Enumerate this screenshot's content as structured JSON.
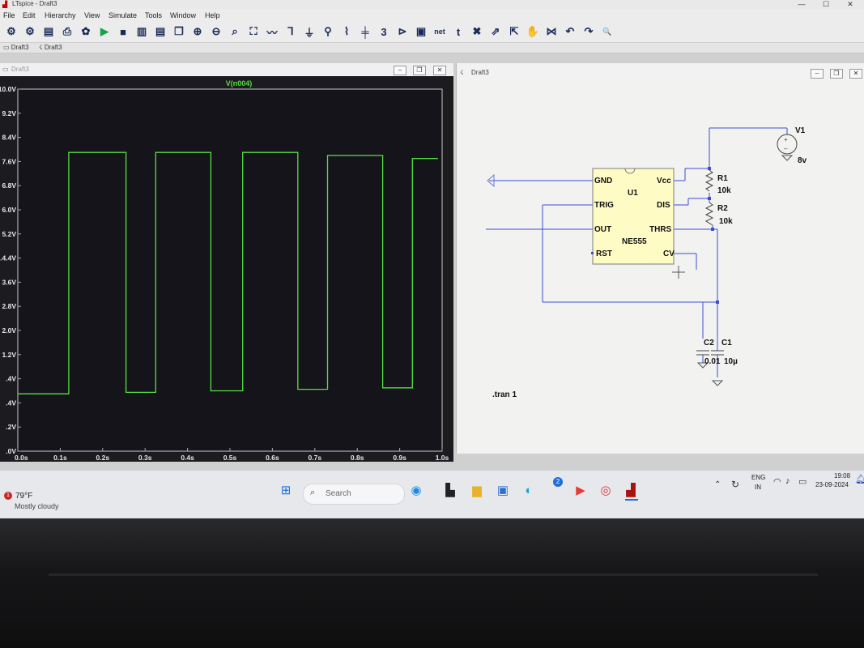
{
  "window": {
    "title": "LTspice - Draft3",
    "minimize": "—",
    "maximize": "☐",
    "close": "✕"
  },
  "menu": [
    "File",
    "Edit",
    "Hierarchy",
    "View",
    "Simulate",
    "Tools",
    "Window",
    "Help"
  ],
  "toolbar_icons": [
    {
      "name": "open-icon",
      "glyph": "⚙"
    },
    {
      "name": "open-folder-icon",
      "glyph": "⚙"
    },
    {
      "name": "save-icon",
      "glyph": "▤"
    },
    {
      "name": "print-icon",
      "glyph": "⎙"
    },
    {
      "name": "control-panel-icon",
      "glyph": "✿"
    },
    {
      "name": "run-icon",
      "glyph": "▶"
    },
    {
      "name": "halt-icon",
      "glyph": "■"
    },
    {
      "name": "tile-vertical-icon",
      "glyph": "▥"
    },
    {
      "name": "tile-horizontal-icon",
      "glyph": "▤"
    },
    {
      "name": "cascade-icon",
      "glyph": "❐"
    },
    {
      "name": "zoom-in-icon",
      "glyph": "⊕"
    },
    {
      "name": "zoom-out-icon",
      "glyph": "⊖"
    },
    {
      "name": "zoom-area-icon",
      "glyph": "⌕"
    },
    {
      "name": "zoom-fit-icon",
      "glyph": "⛶"
    },
    {
      "name": "autorange-icon",
      "glyph": "〰"
    },
    {
      "name": "wire-icon",
      "glyph": "⅂"
    },
    {
      "name": "ground-icon",
      "glyph": "⏚"
    },
    {
      "name": "label-net-icon",
      "glyph": "⚲"
    },
    {
      "name": "resistor-icon",
      "glyph": "⌇"
    },
    {
      "name": "capacitor-icon",
      "glyph": "╪"
    },
    {
      "name": "inductor-icon",
      "glyph": "3"
    },
    {
      "name": "diode-icon",
      "glyph": "⊳"
    },
    {
      "name": "component-icon",
      "glyph": "▣"
    },
    {
      "name": "spice-directive-icon",
      "glyph": "net"
    },
    {
      "name": "text-icon",
      "glyph": "t"
    },
    {
      "name": "delete-icon",
      "glyph": "✖"
    },
    {
      "name": "duplicate-icon",
      "glyph": "⇗"
    },
    {
      "name": "move-icon",
      "glyph": "⇱"
    },
    {
      "name": "drag-icon",
      "glyph": "✋"
    },
    {
      "name": "mirror-icon",
      "glyph": "⋈"
    },
    {
      "name": "undo-icon",
      "glyph": "↶"
    },
    {
      "name": "redo-icon",
      "glyph": "↷"
    },
    {
      "name": "find-icon",
      "glyph": "🔍"
    }
  ],
  "tabs": [
    "Draft3",
    "Draft3"
  ],
  "waveform": {
    "tab_label": "Draft3",
    "trace_name": "V(n004)",
    "trace_color": "#55e040"
  },
  "chart_data": {
    "type": "line",
    "title": "V(n004)",
    "xlabel": "",
    "ylabel": "",
    "x_ticks": [
      "0.0s",
      "0.1s",
      "0.2s",
      "0.3s",
      "0.4s",
      "0.5s",
      "0.6s",
      "0.7s",
      "0.8s",
      "0.9s",
      "1.0s"
    ],
    "y_ticks": [
      "10.0V",
      "9.2V",
      "8.4V",
      "7.6V",
      "6.8V",
      "6.0V",
      "5.2V",
      "4.4V",
      "3.6V",
      "2.8V",
      "2.0V",
      "1.2V",
      "0.4V",
      "-0.4V",
      "-1.2V",
      "-2.0V"
    ],
    "y_ticks_visible": [
      "10.0V",
      "9.2V",
      "8.4V",
      "7.6V",
      "6.8V",
      "6.0V",
      "5.2V",
      ".4.4V",
      "3.6V",
      "2.8V",
      "2.0V",
      "1.2V",
      ".4V",
      ".4V",
      ".2V",
      ".0V"
    ],
    "xlim": [
      0,
      1.0
    ],
    "ylim": [
      -2.0,
      10.0
    ],
    "series": [
      {
        "name": "V(n004)",
        "x": [
          0,
          0.12,
          0.12,
          0.255,
          0.255,
          0.325,
          0.325,
          0.455,
          0.455,
          0.53,
          0.53,
          0.66,
          0.66,
          0.73,
          0.73,
          0.86,
          0.86,
          0.93,
          0.93,
          0.99
        ],
        "y": [
          -0.1,
          -0.1,
          7.9,
          7.9,
          -0.05,
          -0.05,
          7.9,
          7.9,
          0.0,
          0.0,
          7.9,
          7.9,
          0.05,
          0.05,
          7.8,
          7.8,
          0.1,
          0.1,
          7.7,
          7.7
        ]
      }
    ]
  },
  "schematic": {
    "tab_label": "Draft3",
    "ic_ref": "U1",
    "ic_part": "NE555",
    "pins": {
      "gnd": "GND",
      "trig": "TRIG",
      "out": "OUT",
      "rst": "RST",
      "vcc": "Vcc",
      "dis": "DIS",
      "thrs": "THRS",
      "cv": "CV"
    },
    "v1_ref": "V1",
    "v1_value": "8v",
    "r1_ref": "R1",
    "r1_value": "10k",
    "r2_ref": "R2",
    "r2_value": "10k",
    "c2_ref": "C2",
    "c1_ref": "C1",
    "c_values": "0.01",
    "c1_value": "10µ",
    "directive": ".tran 1"
  },
  "taskbar": {
    "weather_temp": "79°F",
    "weather_desc": "Mostly cloudy",
    "weather_alert": "1",
    "search_placeholder": "Search",
    "notification_count": "2",
    "lang_line1": "ENG",
    "lang_line2": "IN",
    "time": "19:08",
    "date": "23-09-2024"
  }
}
